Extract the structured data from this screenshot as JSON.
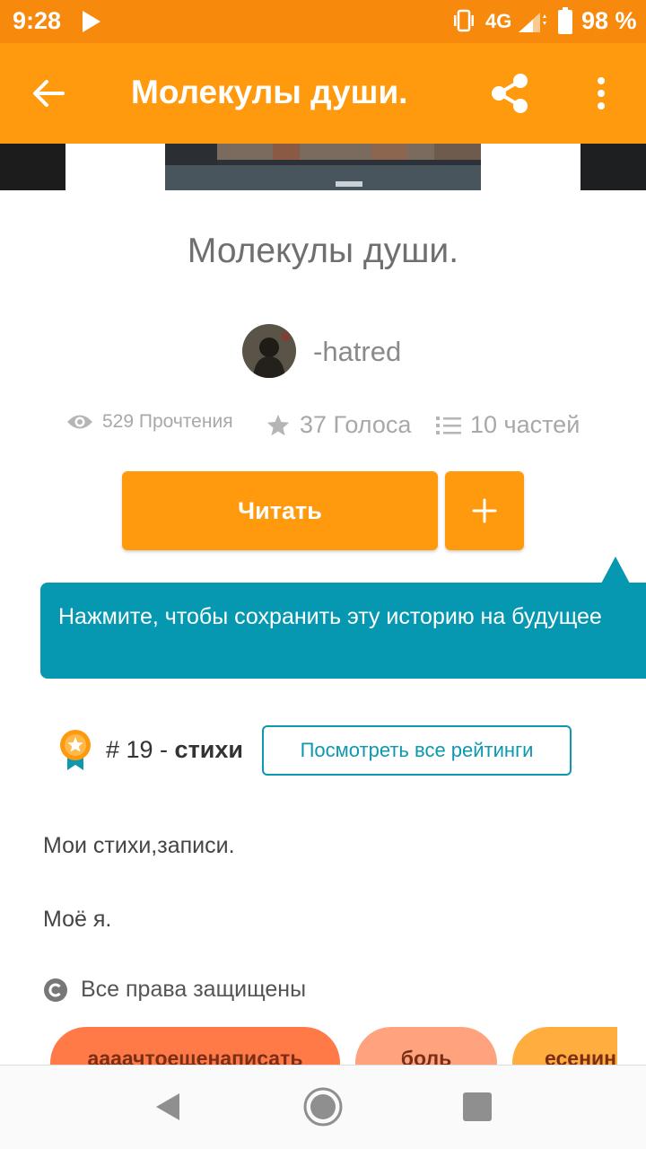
{
  "status_bar": {
    "time": "9:28",
    "network": "4G",
    "battery": "98 %"
  },
  "app_bar": {
    "title": "Молекулы души."
  },
  "story": {
    "title": "Молекулы души.",
    "author": "-hatred",
    "reads": "529 Прочтения",
    "votes": "37 Голоса",
    "parts": "10 частей",
    "read_button": "Читать",
    "add_button": "+"
  },
  "tooltip": {
    "text": "Нажмите, чтобы сохранить эту историю на будущее"
  },
  "ranking": {
    "rank": "# 19 - ",
    "category": "стихи",
    "view_all": "Посмотреть все рейтинги"
  },
  "description": {
    "line1": "Мои стихи,записи.",
    "line2": "Моё я."
  },
  "copyright": {
    "text": "Все права защищены"
  },
  "tags": [
    "аааачтоещенаписать",
    "боль",
    "есенин"
  ],
  "colors": {
    "accent": "#ff9a0e",
    "status_bar": "#f7890d",
    "teal": "#0598b0"
  },
  "icons": {
    "back": "arrow-left-icon",
    "share": "share-icon",
    "more": "more-vert-icon",
    "reads": "eye-icon",
    "votes": "star-icon",
    "parts": "list-icon",
    "rank": "medal-icon",
    "copyright": "copyright-icon"
  }
}
